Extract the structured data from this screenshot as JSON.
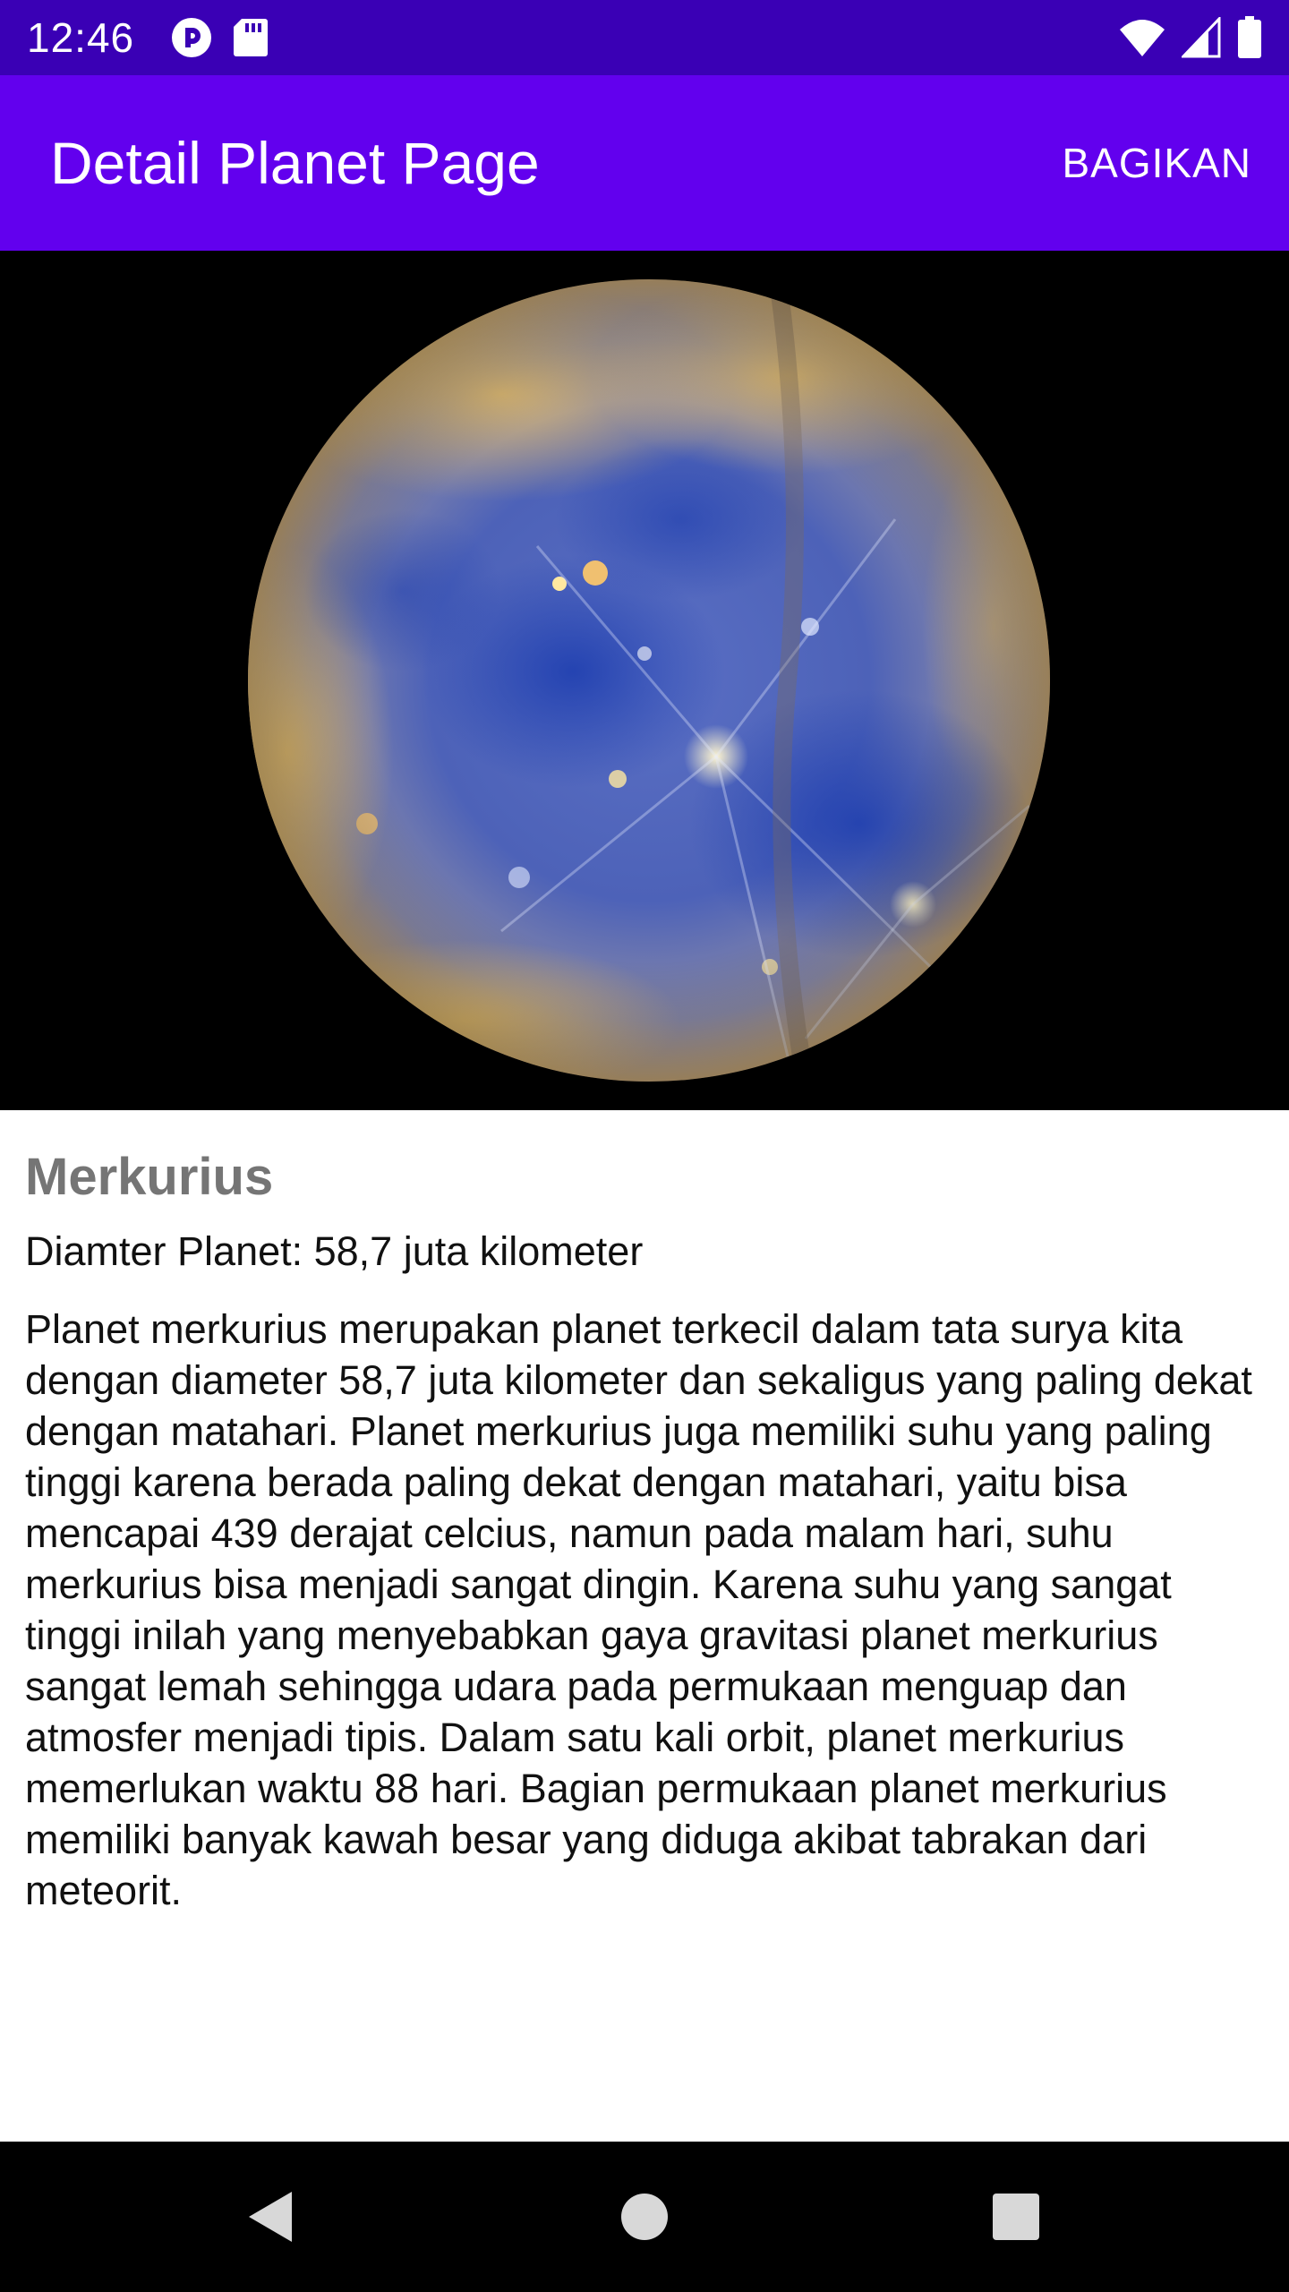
{
  "status_bar": {
    "time": "12:46",
    "icons": [
      "pocket-casts-icon",
      "sd-card-icon",
      "wifi-icon",
      "cell-signal-icon",
      "battery-icon"
    ]
  },
  "app_bar": {
    "title": "Detail Planet Page",
    "action_label": "BAGIKAN"
  },
  "planet": {
    "name": "Merkurius",
    "diameter_text": "Diamter Planet: 58,7 juta kilometer",
    "description": "Planet merkurius merupakan planet terkecil dalam tata surya kita dengan diameter 58,7 juta kilometer dan sekaligus yang paling dekat dengan matahari. Planet merkurius juga memiliki suhu yang paling tinggi karena berada paling dekat dengan matahari, yaitu bisa mencapai 439 derajat celcius, namun pada malam hari, suhu merkurius bisa menjadi sangat dingin. Karena suhu yang sangat tinggi inilah yang menyebabkan gaya gravitasi planet merkurius sangat lemah sehingga udara pada permukaan menguap dan atmosfer menjadi tipis. Dalam satu kali orbit, planet merkurius memerlukan waktu 88 hari. Bagian permukaan planet merkurius memiliki banyak kawah besar yang diduga akibat tabrakan dari meteorit.",
    "image": "mercury-planet-photo"
  },
  "nav_bar": {
    "icons": [
      "back-icon",
      "home-icon",
      "recents-icon"
    ]
  },
  "colors": {
    "status_bar": "#3a00b5",
    "app_bar": "#6200ee",
    "title_text": "#757575",
    "body_text": "#111111",
    "image_background": "#000000",
    "nav_bar": "#000000"
  }
}
